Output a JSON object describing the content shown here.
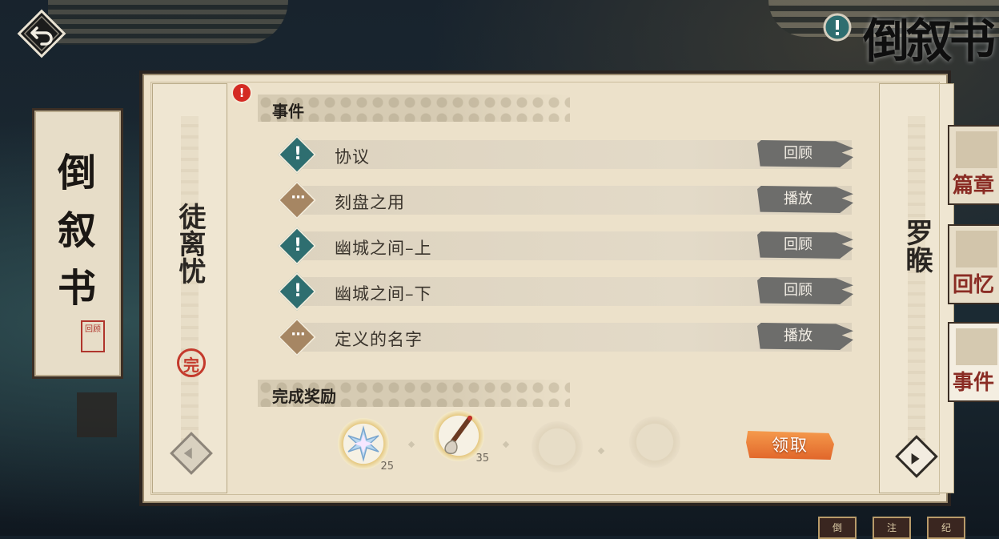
{
  "header": {
    "title": "倒叙书",
    "back_icon": "back-arrow-icon",
    "help_icon": "exclamation-icon"
  },
  "left_banner": {
    "title": "倒叙书",
    "seal": "回顾"
  },
  "panel": {
    "left_character": "徒离忧",
    "left_character_status": "完",
    "right_character": "罗睺",
    "alert_badge": "!",
    "events_heading": "事件",
    "events": [
      {
        "icon": "exclamation-icon",
        "glyph": "!",
        "label": "协议",
        "action": "回顾"
      },
      {
        "icon": "dots-icon",
        "glyph": "···",
        "label": "刻盘之用",
        "action": "播放"
      },
      {
        "icon": "exclamation-icon",
        "glyph": "!",
        "label": "幽城之间–上",
        "action": "回顾"
      },
      {
        "icon": "exclamation-icon",
        "glyph": "!",
        "label": "幽城之间–下",
        "action": "回顾"
      },
      {
        "icon": "dots-icon",
        "glyph": "···",
        "label": "定义的名字",
        "action": "播放"
      }
    ],
    "rewards_heading": "完成奖励",
    "rewards": [
      {
        "icon": "crystal-star-icon",
        "count": "25"
      },
      {
        "icon": "brush-icon",
        "count": "35"
      },
      {
        "icon": "empty-slot-icon",
        "count": ""
      },
      {
        "icon": "empty-slot-icon",
        "count": ""
      }
    ],
    "claim_label": "领取"
  },
  "right_tabs": [
    {
      "label": "篇章",
      "active": false
    },
    {
      "label": "回忆",
      "active": false
    },
    {
      "label": "事件",
      "active": true
    }
  ],
  "bottom_tabs": [
    "倒",
    "注",
    "纪"
  ],
  "colors": {
    "paper": "#ece1ca",
    "teal_icon": "#2e6e70",
    "tan_icon": "#a68663",
    "action_grey": "#6d6d6b",
    "claim_orange": "#ef8038",
    "alert_red": "#d42a23"
  }
}
